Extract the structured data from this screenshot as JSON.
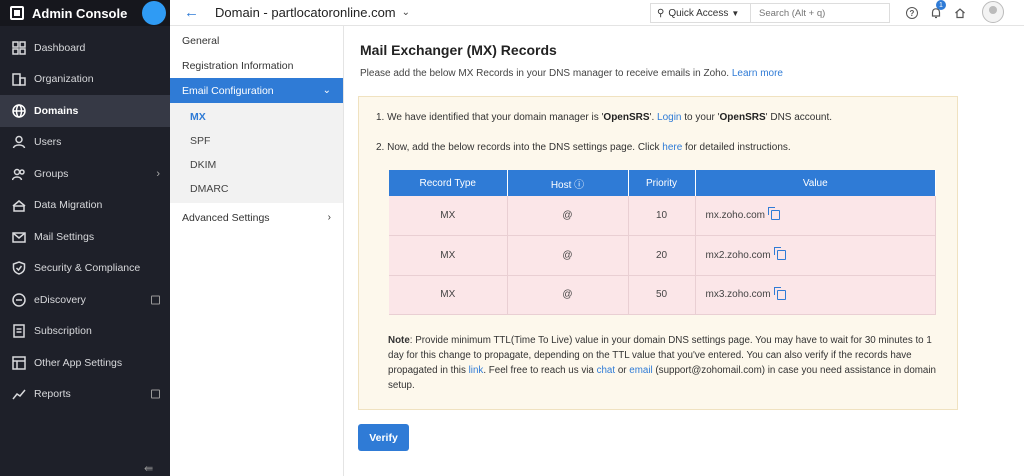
{
  "app": {
    "title": "Admin Console"
  },
  "sidebar": {
    "items": [
      {
        "label": "Dashboard",
        "icon": "dashboard-icon"
      },
      {
        "label": "Organization",
        "icon": "organization-icon"
      },
      {
        "label": "Domains",
        "icon": "globe-icon",
        "active": true
      },
      {
        "label": "Users",
        "icon": "user-icon"
      },
      {
        "label": "Groups",
        "icon": "groups-icon",
        "has_children": true
      },
      {
        "label": "Data Migration",
        "icon": "migration-icon"
      },
      {
        "label": "Mail Settings",
        "icon": "mail-settings-icon"
      },
      {
        "label": "Security & Compliance",
        "icon": "shield-icon"
      },
      {
        "label": "eDiscovery",
        "icon": "ediscovery-icon",
        "external": true
      },
      {
        "label": "Subscription",
        "icon": "subscription-icon"
      },
      {
        "label": "Other App Settings",
        "icon": "apps-icon"
      },
      {
        "label": "Reports",
        "icon": "reports-icon",
        "external": true
      }
    ],
    "collapse_glyph": "⇚"
  },
  "header": {
    "domain_title": "Domain - partlocatoronline.com",
    "quick_access_label": "Quick Access",
    "search_placeholder": "Search (Alt + q)",
    "notification_count": "1"
  },
  "submenu": {
    "general": "General",
    "registration": "Registration Information",
    "email_config": "Email Configuration",
    "children": [
      "MX",
      "SPF",
      "DKIM",
      "DMARC"
    ],
    "advanced": "Advanced Settings"
  },
  "main": {
    "title": "Mail Exchanger (MX) Records",
    "subtitle": "Please add the below MX Records in your DNS manager to receive emails in Zoho.",
    "learn_more": "Learn more",
    "step1": {
      "prefix": "1. We have identified that your domain manager is '",
      "manager": "OpenSRS",
      "mid1": "'. ",
      "login": "Login",
      "mid2": " to your '",
      "manager2": "OpenSRS",
      "suffix": "' DNS account."
    },
    "step2": {
      "prefix": "2. Now, add the below records into the DNS settings page. Click ",
      "here": "here",
      "suffix": " for detailed instructions."
    },
    "table": {
      "headers": [
        "Record Type",
        "Host ⓘ",
        "Priority",
        "Value"
      ],
      "rows": [
        {
          "type": "MX",
          "host": "@",
          "priority": "10",
          "value": "mx.zoho.com"
        },
        {
          "type": "MX",
          "host": "@",
          "priority": "20",
          "value": "mx2.zoho.com"
        },
        {
          "type": "MX",
          "host": "@",
          "priority": "50",
          "value": "mx3.zoho.com"
        }
      ]
    },
    "note": {
      "label": "Note",
      "part1": ": Provide minimum TTL(Time To Live) value in your domain DNS settings page. You may have to wait for 30 minutes to 1 day for this change to propagate, depending on the TTL value that you've entered. You can also verify if the records have propagated in this ",
      "link": "link",
      "part2": ". Feel free to reach us via ",
      "chat": "chat",
      "part3": " or ",
      "email": "email",
      "part4": " (support@zohomail.com) in case you need assistance in domain setup."
    },
    "verify_label": "Verify"
  },
  "colors": {
    "accent": "#2f7bd6",
    "sidebar_bg": "#1e2029",
    "info_bg": "#fdf8ec",
    "row_bg": "#fbe6e8"
  }
}
